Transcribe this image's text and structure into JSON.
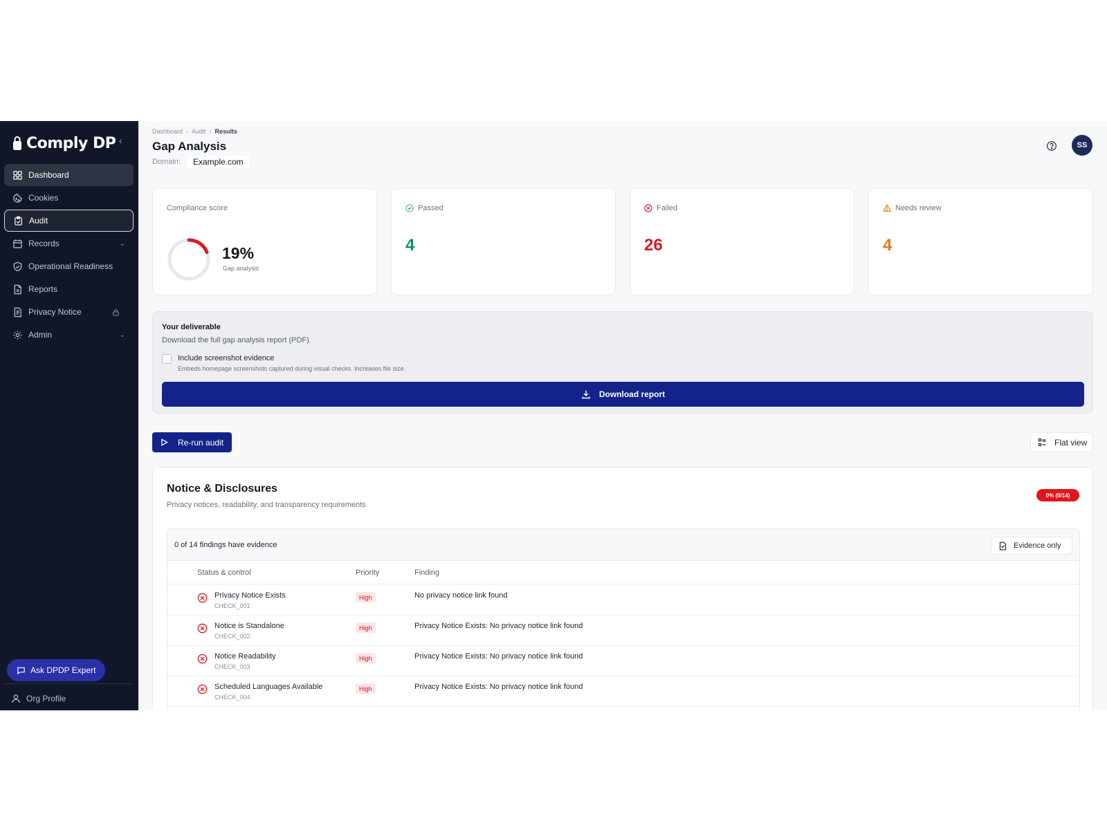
{
  "brand": {
    "name": "Comply DP"
  },
  "sidebar": {
    "collapse_icon": "chevron-left-icon",
    "items": [
      {
        "label": "Dashboard",
        "icon": "grid-icon",
        "state": "hover"
      },
      {
        "label": "Cookies",
        "icon": "cookie-icon"
      },
      {
        "label": "Audit",
        "icon": "clipboard-icon",
        "state": "selected"
      },
      {
        "label": "Records",
        "icon": "calendar-icon",
        "expandable": true
      },
      {
        "label": "Operational Readiness",
        "icon": "shield-check-icon"
      },
      {
        "label": "Reports",
        "icon": "file-icon"
      },
      {
        "label": "Privacy Notice",
        "icon": "document-icon",
        "locked": true
      },
      {
        "label": "Admin",
        "icon": "gear-icon",
        "expandable": true
      }
    ],
    "ask_label": "Ask DPDP Expert",
    "org_label": "Org Profile"
  },
  "header": {
    "breadcrumb": [
      "Dashboard",
      "Audit",
      "Results"
    ],
    "title": "Gap Analysis",
    "domain_label": "Domain:",
    "domain_value": "Example.com",
    "avatar_initials": "SS"
  },
  "stats": {
    "compliance": {
      "label": "Compliance score",
      "value": "19%",
      "percent": 19,
      "sub": "Gap analysis"
    },
    "passed": {
      "label": "Passed",
      "value": "4",
      "color": "#12915a"
    },
    "failed": {
      "label": "Failed",
      "value": "26",
      "color": "#dc1a22"
    },
    "review": {
      "label": "Needs review",
      "value": "4",
      "color": "#e07a10"
    }
  },
  "deliverable": {
    "title": "Your deliverable",
    "description": "Download the full gap analysis report (PDF).",
    "checkbox_label": "Include screenshot evidence",
    "checkbox_checked": false,
    "checkbox_help": "Embeds homepage screenshots captured during visual checks. Increases file size.",
    "download_label": "Download report"
  },
  "actions": {
    "rerun_label": "Re-run audit",
    "flat_label": "Flat view"
  },
  "section": {
    "title": "Notice & Disclosures",
    "subtitle": "Privacy notices, readability, and transparency requirements",
    "badge": "0% (0/14)",
    "evidence_count": "0 of 14 findings have evidence",
    "evidence_filter": "Evidence only",
    "columns": {
      "status": "Status & control",
      "priority": "Priority",
      "finding": "Finding"
    },
    "rows": [
      {
        "name": "Privacy Notice Exists",
        "id": "CHECK_001",
        "priority": "High",
        "finding": "No privacy notice link found"
      },
      {
        "name": "Notice is Standalone",
        "id": "CHECK_002",
        "priority": "High",
        "finding": "Privacy Notice Exists: No privacy notice link found"
      },
      {
        "name": "Notice Readability",
        "id": "CHECK_003",
        "priority": "High",
        "finding": "Privacy Notice Exists: No privacy notice link found"
      },
      {
        "name": "Scheduled Languages Available",
        "id": "CHECK_004",
        "priority": "High",
        "finding": "Privacy Notice Exists: No privacy notice link found"
      }
    ]
  },
  "colors": {
    "sidebar": "#111729",
    "primary": "#14238a",
    "danger": "#dc1a22",
    "success": "#12915a",
    "warning": "#e07a10"
  }
}
